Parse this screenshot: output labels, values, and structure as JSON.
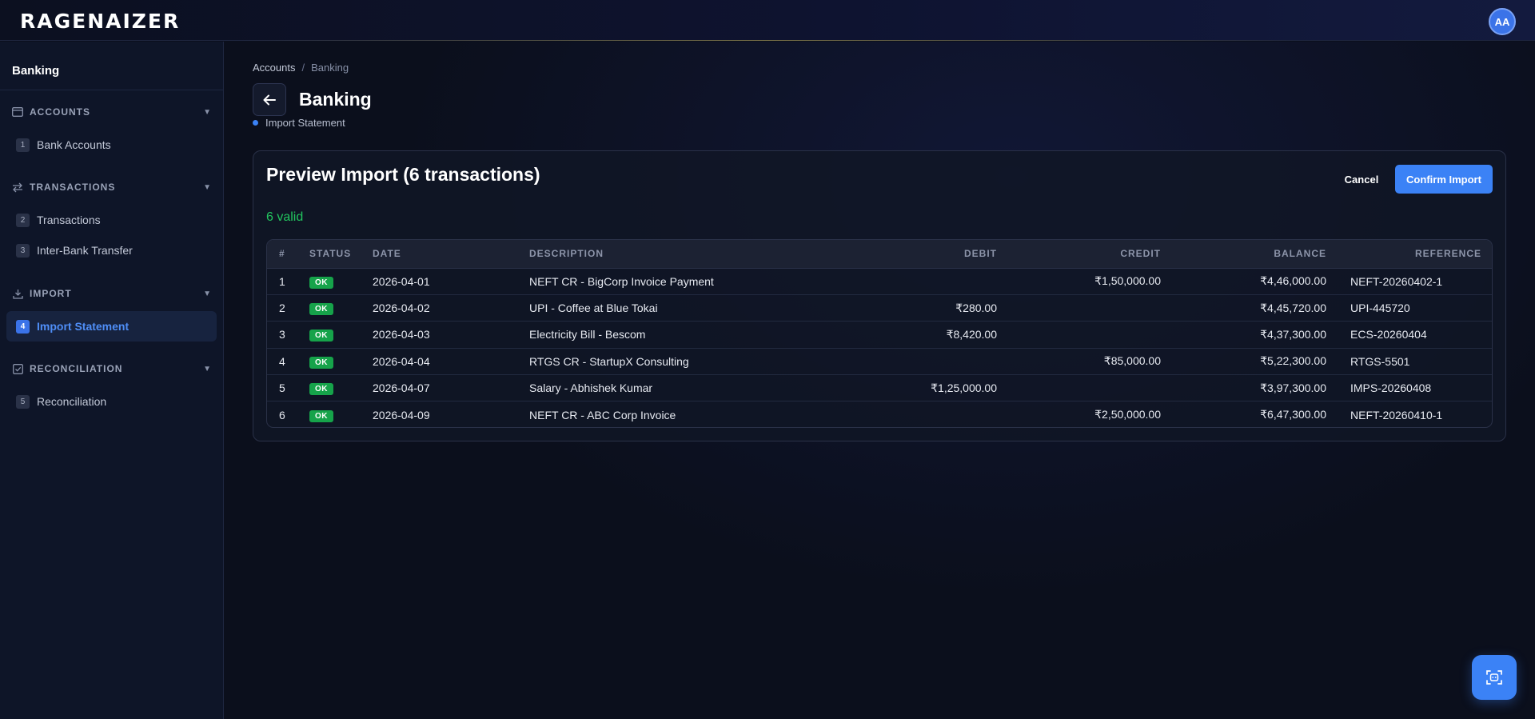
{
  "app": {
    "logo_text": "RAGENAIZER",
    "avatar_initials": "AA"
  },
  "sidebar": {
    "title": "Banking",
    "sections": [
      {
        "label": "ACCOUNTS",
        "icon": "card-icon",
        "items": [
          {
            "num": "1",
            "label": "Bank Accounts"
          }
        ]
      },
      {
        "label": "TRANSACTIONS",
        "icon": "transfer-icon",
        "items": [
          {
            "num": "2",
            "label": "Transactions"
          },
          {
            "num": "3",
            "label": "Inter-Bank Transfer"
          }
        ]
      },
      {
        "label": "IMPORT",
        "icon": "download-icon",
        "items": [
          {
            "num": "4",
            "label": "Import Statement",
            "active": true
          }
        ]
      },
      {
        "label": "RECONCILIATION",
        "icon": "check-square-icon",
        "items": [
          {
            "num": "5",
            "label": "Reconciliation"
          }
        ]
      }
    ]
  },
  "breadcrumb": {
    "parent": "Accounts",
    "separator": "/",
    "current": "Banking"
  },
  "page": {
    "title": "Banking",
    "sub_status": "Import Statement"
  },
  "preview": {
    "title": "Preview Import (6 transactions)",
    "valid_text": "6 valid",
    "cancel_label": "Cancel",
    "confirm_label": "Confirm Import",
    "columns": [
      "#",
      "STATUS",
      "DATE",
      "DESCRIPTION",
      "DEBIT",
      "CREDIT",
      "BALANCE",
      "REFERENCE"
    ],
    "rows": [
      {
        "n": "1",
        "status": "OK",
        "date": "2026-04-01",
        "desc": "NEFT CR - BigCorp Invoice Payment",
        "debit": "",
        "credit": "₹1,50,000.00",
        "balance": "₹4,46,000.00",
        "ref": "NEFT-20260402-1"
      },
      {
        "n": "2",
        "status": "OK",
        "date": "2026-04-02",
        "desc": "UPI - Coffee at Blue Tokai",
        "debit": "₹280.00",
        "credit": "",
        "balance": "₹4,45,720.00",
        "ref": "UPI-445720"
      },
      {
        "n": "3",
        "status": "OK",
        "date": "2026-04-03",
        "desc": "Electricity Bill - Bescom",
        "debit": "₹8,420.00",
        "credit": "",
        "balance": "₹4,37,300.00",
        "ref": "ECS-20260404"
      },
      {
        "n": "4",
        "status": "OK",
        "date": "2026-04-04",
        "desc": "RTGS CR - StartupX Consulting",
        "debit": "",
        "credit": "₹85,000.00",
        "balance": "₹5,22,300.00",
        "ref": "RTGS-5501"
      },
      {
        "n": "5",
        "status": "OK",
        "date": "2026-04-07",
        "desc": "Salary - Abhishek Kumar",
        "debit": "₹1,25,000.00",
        "credit": "",
        "balance": "₹3,97,300.00",
        "ref": "IMPS-20260408"
      },
      {
        "n": "6",
        "status": "OK",
        "date": "2026-04-09",
        "desc": "NEFT CR - ABC Corp Invoice",
        "debit": "",
        "credit": "₹2,50,000.00",
        "balance": "₹6,47,300.00",
        "ref": "NEFT-20260410-1"
      }
    ]
  },
  "colors": {
    "accent": "#3b82f6",
    "success": "#22c55e",
    "badge": "#16a34a",
    "bg": "#0b0f1c",
    "sidebar": "#0e1528"
  },
  "fab": {
    "icon": "ai-scan-icon"
  }
}
